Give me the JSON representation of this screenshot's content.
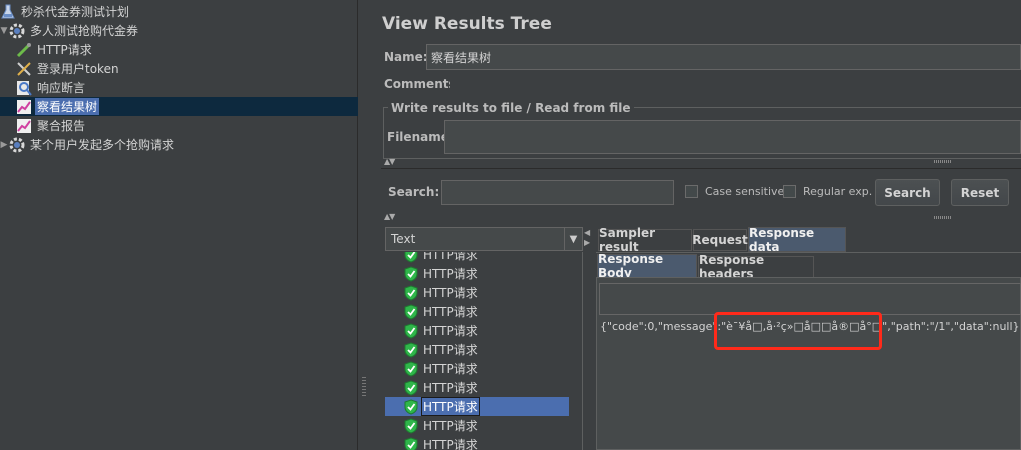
{
  "tree": {
    "items": [
      {
        "label": "秒杀代金券测试计划",
        "icon": "flask-icon"
      },
      {
        "label": "多人测试抢购代金券",
        "icon": "gear-icon"
      },
      {
        "label": "HTTP请求",
        "icon": "pipette-icon"
      },
      {
        "label": "登录用户token",
        "icon": "tools-icon"
      },
      {
        "label": "响应断言",
        "icon": "magnifier-icon"
      },
      {
        "label": "察看结果树",
        "icon": "chart-icon"
      },
      {
        "label": "聚合报告",
        "icon": "chart-icon"
      },
      {
        "label": "某个用户发起多个抢购请求",
        "icon": "gear-icon"
      }
    ]
  },
  "panel": {
    "title": "View Results Tree",
    "name_label": "Name:",
    "name_value": "察看结果树",
    "comments_label": "Comments:",
    "write_results_label": "Write results to file / Read from file",
    "filename_label": "Filename"
  },
  "search": {
    "label": "Search:",
    "case_sensitive": "Case sensitive",
    "regex": "Regular exp.",
    "search_button": "Search",
    "reset_button": "Reset"
  },
  "results": {
    "renderer": "Text",
    "rows": [
      "HTTP请求",
      "HTTP请求",
      "HTTP请求",
      "HTTP请求",
      "HTTP请求",
      "HTTP请求",
      "HTTP请求",
      "HTTP请求",
      "HTTP请求",
      "HTTP请求",
      "HTTP请求"
    ]
  },
  "tabs": {
    "sampler_result": "Sampler result",
    "request": "Request",
    "response_data": "Response data",
    "response_body": "Response Body",
    "response_headers": "Response headers"
  },
  "response": {
    "text": "{\"code\":0,\"message\":\"è¯¥å□,å·²ç»□å□□å®□å°□\",\"path\":\"/1\",\"data\":null}"
  },
  "colors": {
    "highlight": "#ff2a1a",
    "selection": "#4b6eaf",
    "shield": "#2fb64a"
  }
}
